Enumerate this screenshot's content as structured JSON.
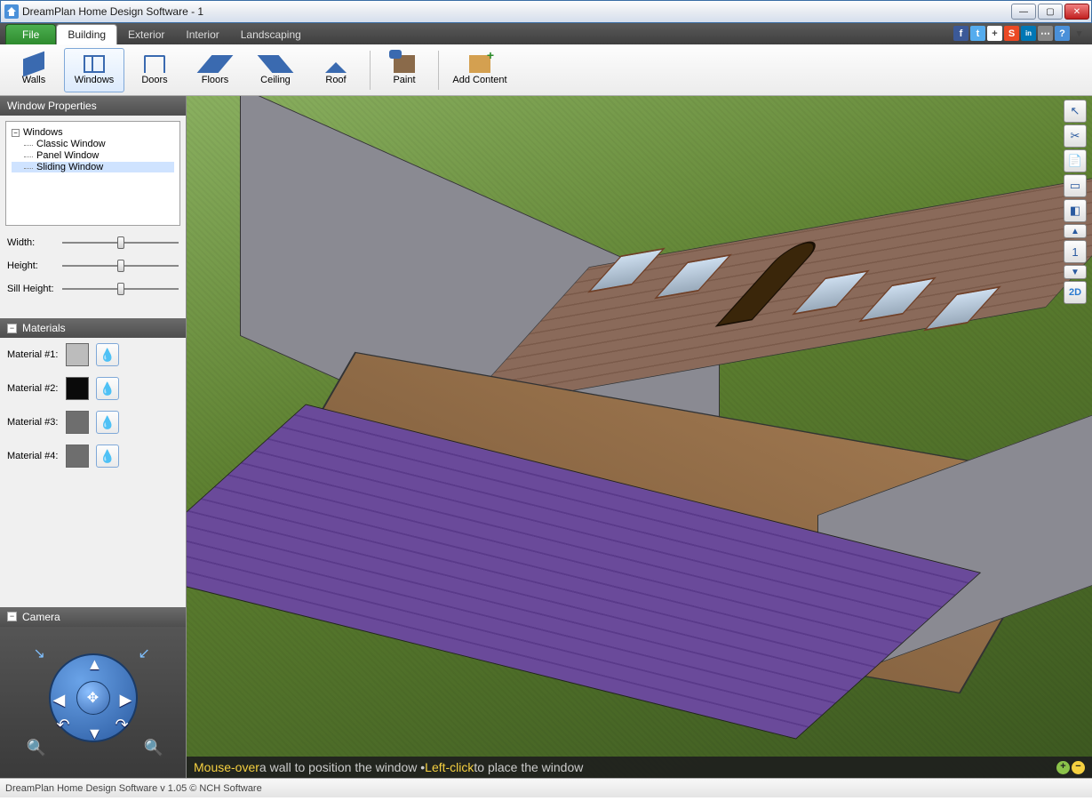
{
  "titlebar": {
    "title": "DreamPlan Home Design Software - 1"
  },
  "tabs": {
    "file": "File",
    "items": [
      "Building",
      "Exterior",
      "Interior",
      "Landscaping"
    ],
    "active": "Building"
  },
  "toolbar": {
    "walls": "Walls",
    "windows": "Windows",
    "doors": "Doors",
    "floors": "Floors",
    "ceiling": "Ceiling",
    "roof": "Roof",
    "paint": "Paint",
    "add_content": "Add Content",
    "active": "Windows"
  },
  "properties": {
    "title": "Window Properties",
    "tree_root": "Windows",
    "tree_items": [
      "Classic Window",
      "Panel Window",
      "Sliding Window"
    ],
    "tree_selected": "Sliding Window",
    "sliders": {
      "width": {
        "label": "Width:",
        "value": 50
      },
      "height": {
        "label": "Height:",
        "value": 50
      },
      "sill": {
        "label": "Sill Height:",
        "value": 50
      }
    }
  },
  "materials": {
    "title": "Materials",
    "rows": [
      {
        "label": "Material #1:",
        "color": "#bcbcbc"
      },
      {
        "label": "Material #2:",
        "color": "#0a0a0a"
      },
      {
        "label": "Material #3:",
        "color": "#6e6e6e"
      },
      {
        "label": "Material #4:",
        "color": "#6e6e6e"
      }
    ]
  },
  "camera": {
    "title": "Camera"
  },
  "right_tools": {
    "select_icon": "↖",
    "scissors_icon": "✂",
    "copy_icon": "📄",
    "plane_icon": "▭",
    "cube_icon": "◧",
    "up_icon": "▲",
    "story_icon": "1",
    "down_icon": "▼",
    "view2d": "2D"
  },
  "hint": {
    "p1": "Mouse-over",
    "p2": " a wall to position the window • ",
    "p3": "Left-click",
    "p4": " to place the window"
  },
  "statusbar": {
    "text": "DreamPlan Home Design Software v 1.05 © NCH Software"
  },
  "social_icons": [
    {
      "name": "facebook-icon",
      "bg": "#3b5998",
      "glyph": "f"
    },
    {
      "name": "twitter-icon",
      "bg": "#55acee",
      "glyph": "t"
    },
    {
      "name": "google-plus-icon",
      "bg": "#ffffff",
      "glyph": "+"
    },
    {
      "name": "stumbleupon-icon",
      "bg": "#eb4924",
      "glyph": "S"
    },
    {
      "name": "linkedin-icon",
      "bg": "#0077b5",
      "glyph": "in"
    },
    {
      "name": "more-icon",
      "bg": "#888888",
      "glyph": "⋯"
    },
    {
      "name": "help-icon",
      "bg": "#4a90d9",
      "glyph": "?"
    },
    {
      "name": "help-dropdown-icon",
      "bg": "transparent",
      "glyph": "▾"
    }
  ]
}
